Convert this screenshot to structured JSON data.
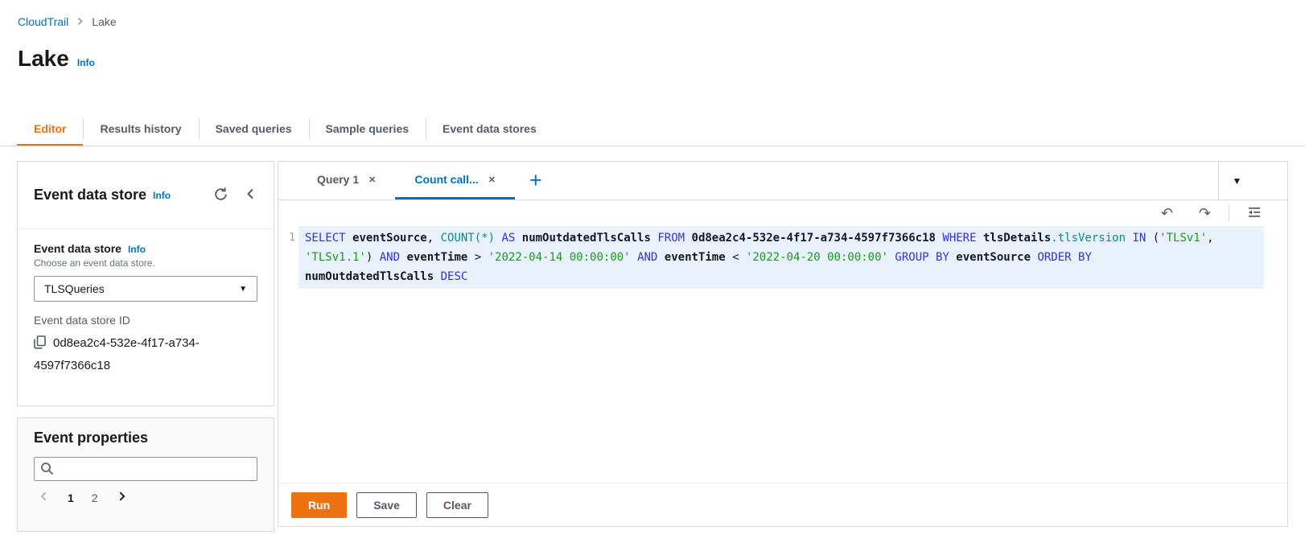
{
  "colors": {
    "accent": "#ec7211",
    "link": "#0073bb",
    "active_query_tab": "#0073bb",
    "highlight_line": "#e8f1fc"
  },
  "icons": {
    "caret_down": "▼",
    "close": "✕",
    "add_tab": "+",
    "undo": "↶",
    "redo": "↷"
  },
  "breadcrumb": {
    "items": [
      {
        "label": "CloudTrail"
      },
      {
        "label": "Lake"
      }
    ]
  },
  "header": {
    "title": "Lake",
    "info": "Info"
  },
  "nav_tabs": [
    {
      "label": "Editor",
      "active": true
    },
    {
      "label": "Results history",
      "active": false
    },
    {
      "label": "Saved queries",
      "active": false
    },
    {
      "label": "Sample queries",
      "active": false
    },
    {
      "label": "Event data stores",
      "active": false
    }
  ],
  "sidebar": {
    "panel_title": "Event data store",
    "panel_info": "Info",
    "store_label": "Event data store",
    "store_info": "Info",
    "store_help": "Choose an event data store.",
    "store_value": "TLSQueries",
    "id_label": "Event data store ID",
    "id_value": "0d8ea2c4-532e-4f17-a734-4597f7366c18",
    "properties": {
      "title": "Event properties",
      "pages": [
        "1",
        "2"
      ],
      "current_page": "1"
    }
  },
  "editor": {
    "tabs": [
      {
        "label": "Query 1",
        "active": false
      },
      {
        "label": "Count call...",
        "active": true
      }
    ],
    "line_number": "1",
    "buttons": {
      "run": "Run",
      "save": "Save",
      "clear": "Clear"
    }
  },
  "sql": {
    "tokens": [
      {
        "type": "kw",
        "text": "SELECT"
      },
      {
        "type": "pl",
        "text": " "
      },
      {
        "type": "id",
        "text": "eventSource"
      },
      {
        "type": "pl",
        "text": ", "
      },
      {
        "type": "fn",
        "text": "COUNT(*)"
      },
      {
        "type": "pl",
        "text": " "
      },
      {
        "type": "kw",
        "text": "AS"
      },
      {
        "type": "pl",
        "text": " "
      },
      {
        "type": "id",
        "text": "numOutdatedTlsCalls"
      },
      {
        "type": "pl",
        "text": " "
      },
      {
        "type": "kw",
        "text": "FROM"
      },
      {
        "type": "pl",
        "text": " "
      },
      {
        "type": "id",
        "text": "0d8ea2c4-532e-4f17-a734-4597f7366c18"
      },
      {
        "type": "pl",
        "text": " "
      },
      {
        "type": "kw",
        "text": "WHERE"
      },
      {
        "type": "pl",
        "text": " "
      },
      {
        "type": "id",
        "text": "tlsDetails"
      },
      {
        "type": "fn",
        "text": ".tlsVersion"
      },
      {
        "type": "pl",
        "text": " "
      },
      {
        "type": "kw",
        "text": "IN"
      },
      {
        "type": "pl",
        "text": " ("
      },
      {
        "type": "str",
        "text": "'TLSv1'"
      },
      {
        "type": "pl",
        "text": ", "
      },
      {
        "type": "str",
        "text": "'TLSv1.1'"
      },
      {
        "type": "pl",
        "text": ") "
      },
      {
        "type": "kw",
        "text": "AND"
      },
      {
        "type": "pl",
        "text": " "
      },
      {
        "type": "id",
        "text": "eventTime"
      },
      {
        "type": "op",
        "text": " > "
      },
      {
        "type": "str",
        "text": "'2022-04-14 00:00:00'"
      },
      {
        "type": "pl",
        "text": " "
      },
      {
        "type": "kw",
        "text": "AND"
      },
      {
        "type": "pl",
        "text": " "
      },
      {
        "type": "id",
        "text": "eventTime"
      },
      {
        "type": "op",
        "text": " < "
      },
      {
        "type": "str",
        "text": "'2022-04-20 00:00:00'"
      },
      {
        "type": "pl",
        "text": " "
      },
      {
        "type": "kw",
        "text": "GROUP BY"
      },
      {
        "type": "pl",
        "text": " "
      },
      {
        "type": "id",
        "text": "eventSource"
      },
      {
        "type": "pl",
        "text": " "
      },
      {
        "type": "kw",
        "text": "ORDER BY"
      },
      {
        "type": "pl",
        "text": " "
      },
      {
        "type": "id",
        "text": "numOutdatedTlsCalls"
      },
      {
        "type": "pl",
        "text": " "
      },
      {
        "type": "kw",
        "text": "DESC"
      }
    ]
  }
}
